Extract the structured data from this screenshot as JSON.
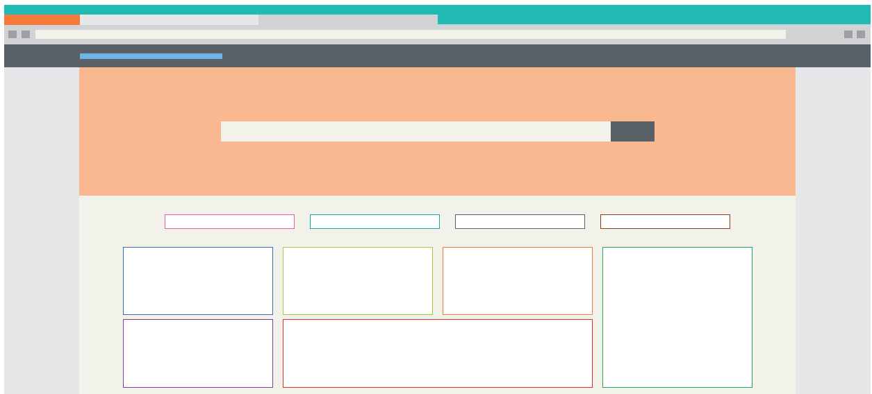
{
  "colors": {
    "title_bar": "#22bab5",
    "tab_strip": "#d1d2d4",
    "tab_active": "#f5793b",
    "tab_inactive": "#e6e7e8",
    "toolbar": "#d1d2d4",
    "nav_button": "#9d9fa2",
    "address_bar": "#f3f2ea",
    "nav_bar": "#596068",
    "logo": "#6bb6e7",
    "window_bg": "#e6e7e8",
    "page_bg": "#f2f1ea",
    "hero_bg": "#f9b890",
    "search_input_bg": "#f3f2ea",
    "search_button_bg": "#596068"
  },
  "browser": {
    "tabs": [
      {
        "state": "active"
      },
      {
        "state": "inactive"
      },
      {
        "state": "inactive"
      }
    ],
    "icons": {
      "back": "back-icon",
      "forward": "forward-icon",
      "menu": "menu-icon"
    },
    "address_value": ""
  },
  "header": {
    "logo_text": ""
  },
  "hero": {
    "search": {
      "value": "",
      "placeholder": "",
      "button_label": ""
    }
  },
  "filters": [
    {
      "label": "",
      "color": "#e35ea2"
    },
    {
      "label": "",
      "color": "#1ea5a2"
    },
    {
      "label": "",
      "color": "#596068"
    },
    {
      "label": "",
      "color": "#8b3f1f"
    }
  ],
  "cards": [
    {
      "color": "#2e6fb6"
    },
    {
      "color": "#a5ce3a"
    },
    {
      "color": "#f5793b"
    },
    {
      "color": "#1fa65a"
    },
    {
      "color": "#7a3f98"
    },
    {
      "color": "#e02b2b"
    }
  ]
}
